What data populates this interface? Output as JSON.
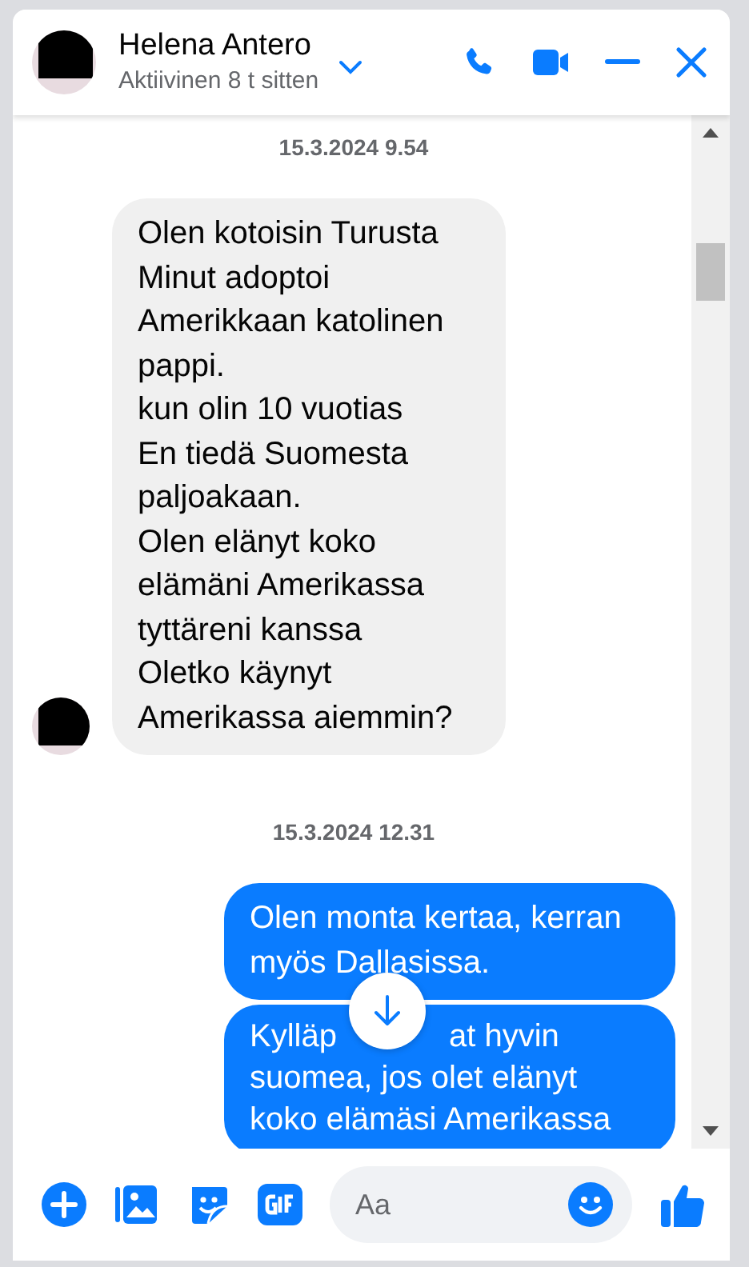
{
  "contact": {
    "name": "Helena Antero",
    "status": "Aktiivinen 8 t sitten"
  },
  "messages": [
    {
      "kind": "date",
      "text": "15.3.2024 9.54"
    },
    {
      "kind": "incoming",
      "text": "Olen kotoisin Turusta\nMinut adoptoi Amerikkaan katolinen pappi.\nkun olin 10 vuotias\nEn tiedä Suomesta paljoakaan.\nOlen elänyt koko elämäni Amerikassa tyttäreni kanssa\nOletko käynyt Amerikassa aiemmin?"
    },
    {
      "kind": "date",
      "text": "15.3.2024 12.31"
    },
    {
      "kind": "outgoing",
      "text": "Olen monta kertaa, kerran myös Dallasissa."
    },
    {
      "kind": "outgoing",
      "lines": [
        [
          "Kylläp",
          "at hyvin"
        ],
        [
          "suomea, jos olet elänyt"
        ],
        [
          "koko elämäsi Amerikassa"
        ]
      ]
    }
  ],
  "composer": {
    "placeholder": "Aa"
  }
}
